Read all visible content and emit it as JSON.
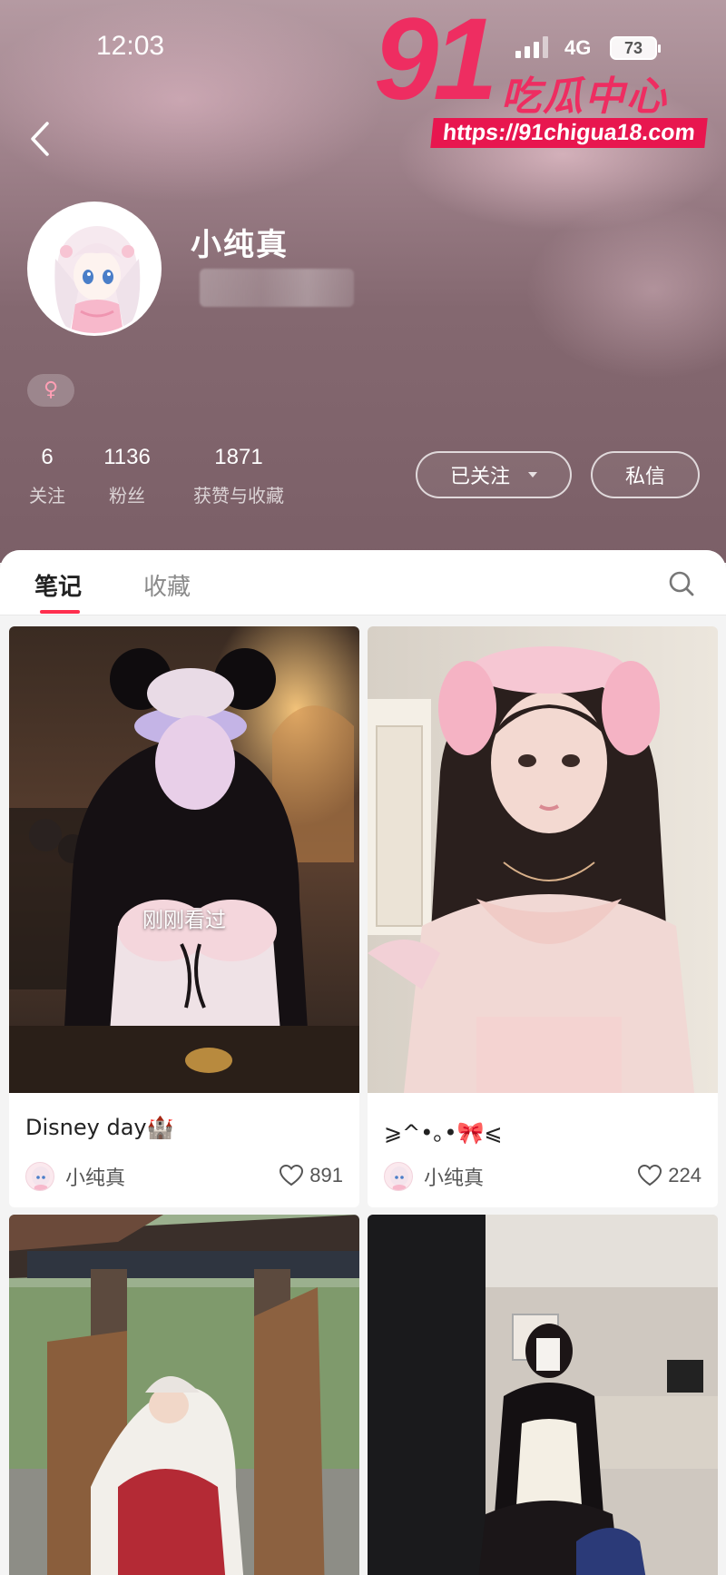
{
  "status_bar": {
    "time": "12:03",
    "network": "4G",
    "battery": "73"
  },
  "watermark": {
    "number": "91",
    "brand": "吃瓜中心",
    "url": "https://91chigua18.com"
  },
  "profile": {
    "username": "小纯真",
    "gender_symbol": "♀",
    "stats": [
      {
        "value": "6",
        "label": "关注"
      },
      {
        "value": "1136",
        "label": "粉丝"
      },
      {
        "value": "1871",
        "label": "获赞与收藏"
      }
    ],
    "follow_button": "已关注",
    "message_button": "私信"
  },
  "tabs": [
    {
      "label": "笔记",
      "active": true
    },
    {
      "label": "收藏",
      "active": false
    }
  ],
  "notes": [
    {
      "title": "Disney day🏰",
      "author": "小纯真",
      "likes": "891",
      "overlay": "刚刚看过"
    },
    {
      "title": "⩾^•｡•🎀⩽",
      "author": "小纯真",
      "likes": "224"
    }
  ],
  "colors": {
    "accent": "#ff2e4d",
    "watermark": "#ee2d61",
    "header_bg": "#8a6d75"
  }
}
